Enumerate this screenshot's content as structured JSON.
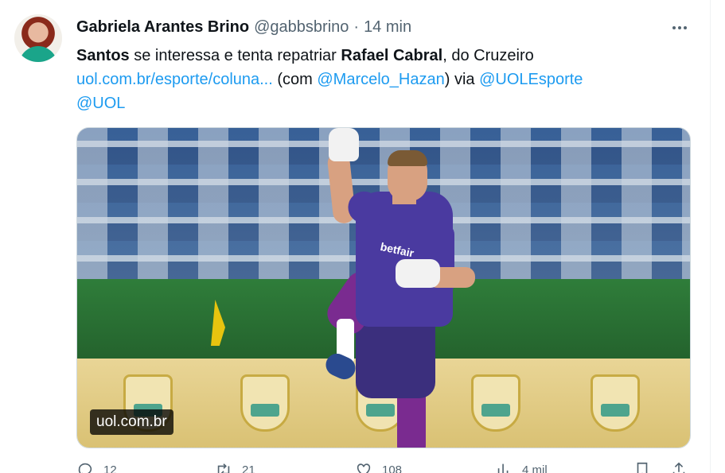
{
  "tweet": {
    "author_name": "Gabriela Arantes Brino",
    "author_handle": "@gabbsbrino",
    "separator": "·",
    "time": "14 min",
    "text": {
      "bold1": "Santos",
      "part1": " se interessa e tenta repatriar ",
      "bold2": "Rafael Cabral",
      "part2": ", do Cruzeiro",
      "link": "uol.com.br/esporte/coluna...",
      "part3": " (com ",
      "mention1": "@Marcelo_Hazan",
      "part4": ") via ",
      "mention2": "@UOLEsporte",
      "mention3": "@UOL"
    },
    "media": {
      "source_label": "uol.com.br",
      "sponsor_text": "betfair"
    },
    "actions": {
      "replies": "12",
      "reposts": "21",
      "likes": "108",
      "views": "4 mil"
    }
  },
  "colors": {
    "link": "#1d9bf0",
    "secondary_text": "#536471",
    "primary_text": "#0f1419"
  },
  "icons": [
    "more-icon",
    "reply-icon",
    "repost-icon",
    "like-icon",
    "views-icon",
    "bookmark-icon",
    "share-icon"
  ]
}
